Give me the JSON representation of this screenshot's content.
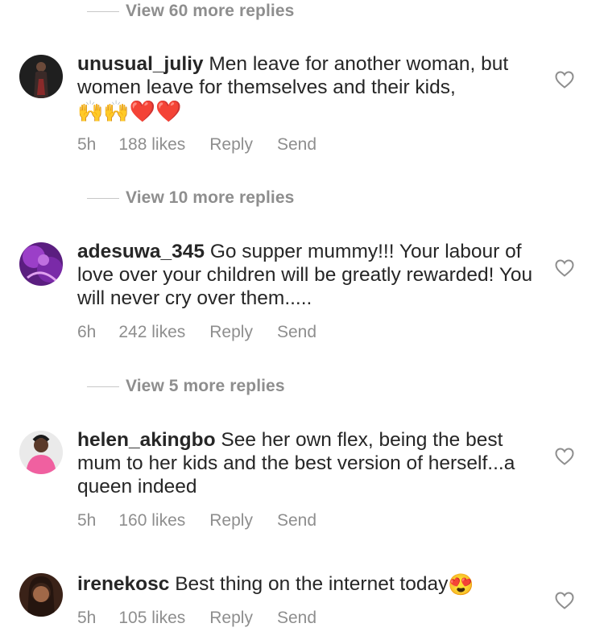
{
  "view_replies": [
    {
      "label": "View 60 more replies"
    },
    {
      "label": "View 10 more replies"
    },
    {
      "label": "View 5 more replies"
    }
  ],
  "comments": [
    {
      "username": "unusual_juliy",
      "text": "Men leave for another woman, but women leave for themselves and their kids,",
      "emoji": "🙌🙌❤️❤️",
      "time": "5h",
      "likes": "188 likes",
      "reply": "Reply",
      "send": "Send",
      "avatar_color": "#2a2a2a"
    },
    {
      "username": "adesuwa_345",
      "text": "Go supper mummy!!! Your labour of love over your children will be greatly rewarded! You will never cry over them.....",
      "time": "6h",
      "likes": "242 likes",
      "reply": "Reply",
      "send": "Send",
      "avatar_color": "#7a2aa0"
    },
    {
      "username": "helen_akingbo",
      "text": "See her own flex, being the best mum to her kids and the best version of herself...a queen indeed",
      "time": "5h",
      "likes": "160 likes",
      "reply": "Reply",
      "send": "Send",
      "avatar_color": "#e86a8a"
    },
    {
      "username": "irenekosc",
      "text": "Best thing on the internet today",
      "emoji": "😍",
      "time": "5h",
      "likes": "105 likes",
      "reply": "Reply",
      "send": "Send",
      "avatar_color": "#4a2a20"
    }
  ],
  "icons": {
    "like": "heart-outline-icon",
    "separator": "reply-line"
  },
  "colors": {
    "text": "#262626",
    "secondary": "#8e8e8e",
    "background": "#ffffff"
  }
}
